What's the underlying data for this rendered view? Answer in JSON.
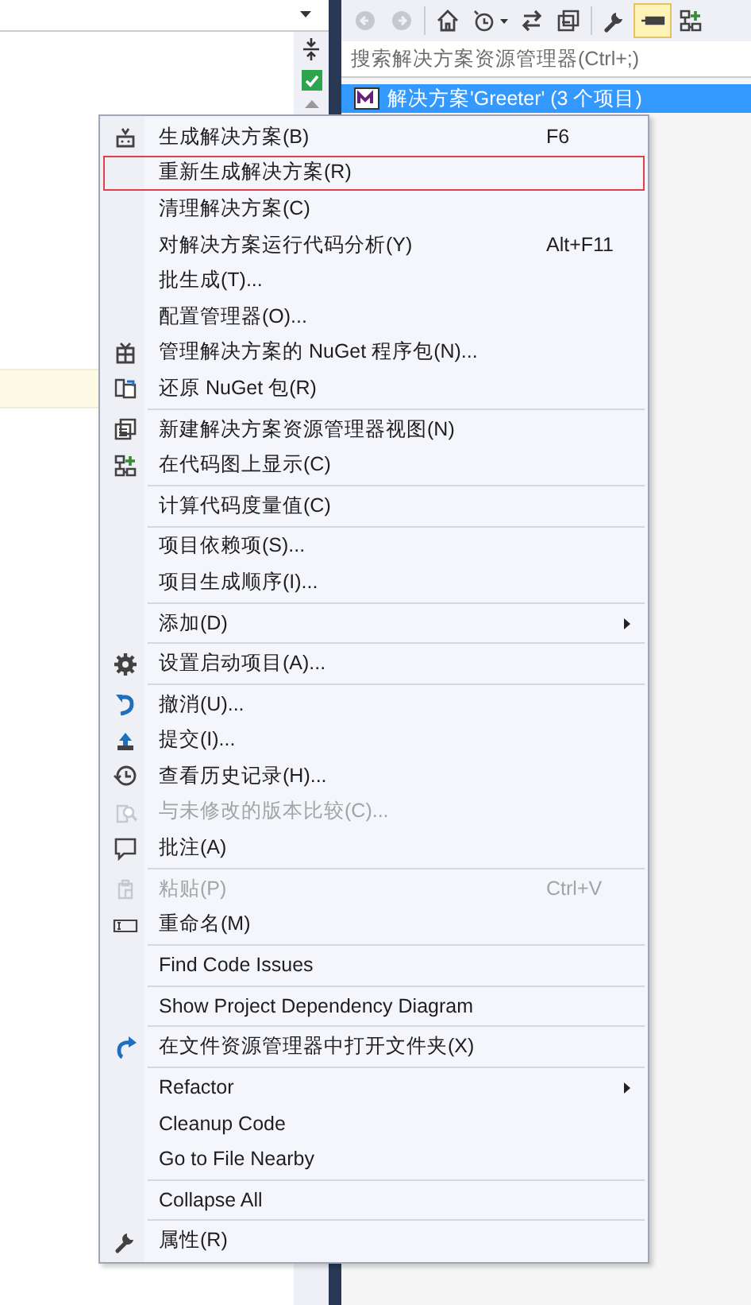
{
  "toolbar": {
    "buttons": [
      {
        "disabled": true,
        "selected": false
      },
      {
        "disabled": true,
        "selected": false
      },
      {
        "disabled": false,
        "selected": false
      },
      {
        "disabled": false,
        "selected": false
      },
      {
        "disabled": false,
        "selected": false
      },
      {
        "disabled": false,
        "selected": false
      },
      {
        "disabled": false,
        "selected": false
      },
      {
        "disabled": false,
        "selected": true
      },
      {
        "disabled": false,
        "selected": false
      }
    ]
  },
  "search": {
    "placeholder": "搜索解决方案资源管理器(Ctrl+;)"
  },
  "tree": {
    "items": [
      {
        "label": "解决方案'Greeter' (3 个项目)",
        "selected": true
      }
    ]
  },
  "context_menu": {
    "items": [
      {
        "kind": "item",
        "label": "生成解决方案(B)",
        "shortcut": "F6",
        "disabled": false,
        "selected": false
      },
      {
        "kind": "item",
        "label": "重新生成解决方案(R)",
        "disabled": false,
        "selected": true
      },
      {
        "kind": "item",
        "label": "清理解决方案(C)",
        "disabled": false,
        "selected": false
      },
      {
        "kind": "item",
        "label": "对解决方案运行代码分析(Y)",
        "shortcut": "Alt+F11",
        "disabled": false,
        "selected": false
      },
      {
        "kind": "item",
        "label": "批生成(T)...",
        "disabled": false,
        "selected": false
      },
      {
        "kind": "item",
        "label": "配置管理器(O)...",
        "disabled": false,
        "selected": false
      },
      {
        "kind": "item",
        "label": "管理解决方案的 NuGet 程序包(N)...",
        "disabled": false,
        "selected": false
      },
      {
        "kind": "item",
        "label": "还原 NuGet 包(R)",
        "disabled": false,
        "selected": false
      },
      {
        "kind": "separator"
      },
      {
        "kind": "item",
        "label": "新建解决方案资源管理器视图(N)",
        "disabled": false,
        "selected": false
      },
      {
        "kind": "item",
        "label": "在代码图上显示(C)",
        "disabled": false,
        "selected": false
      },
      {
        "kind": "separator"
      },
      {
        "kind": "item",
        "label": "计算代码度量值(C)",
        "disabled": false,
        "selected": false
      },
      {
        "kind": "separator"
      },
      {
        "kind": "item",
        "label": "项目依赖项(S)...",
        "disabled": false,
        "selected": false
      },
      {
        "kind": "item",
        "label": "项目生成顺序(I)...",
        "disabled": false,
        "selected": false
      },
      {
        "kind": "separator"
      },
      {
        "kind": "item",
        "label": "添加(D)",
        "submenu": true,
        "disabled": false,
        "selected": false
      },
      {
        "kind": "separator"
      },
      {
        "kind": "item",
        "label": "设置启动项目(A)...",
        "disabled": false,
        "selected": false
      },
      {
        "kind": "separator"
      },
      {
        "kind": "item",
        "label": "撤消(U)...",
        "disabled": false,
        "selected": false
      },
      {
        "kind": "item",
        "label": "提交(I)...",
        "disabled": false,
        "selected": false
      },
      {
        "kind": "item",
        "label": "查看历史记录(H)...",
        "disabled": false,
        "selected": false
      },
      {
        "kind": "item",
        "label": "与未修改的版本比较(C)...",
        "disabled": true,
        "selected": false
      },
      {
        "kind": "item",
        "label": "批注(A)",
        "disabled": false,
        "selected": false
      },
      {
        "kind": "separator"
      },
      {
        "kind": "item",
        "label": "粘贴(P)",
        "shortcut": "Ctrl+V",
        "disabled": true,
        "selected": false
      },
      {
        "kind": "item",
        "label": "重命名(M)",
        "disabled": false,
        "selected": false
      },
      {
        "kind": "separator"
      },
      {
        "kind": "item",
        "label": "Find Code Issues",
        "disabled": false,
        "selected": false
      },
      {
        "kind": "separator"
      },
      {
        "kind": "item",
        "label": "Show Project Dependency Diagram",
        "disabled": false,
        "selected": false
      },
      {
        "kind": "separator"
      },
      {
        "kind": "item",
        "label": "在文件资源管理器中打开文件夹(X)",
        "disabled": false,
        "selected": false
      },
      {
        "kind": "separator"
      },
      {
        "kind": "item",
        "label": "Refactor",
        "submenu": true,
        "disabled": false,
        "selected": false
      },
      {
        "kind": "item",
        "label": "Cleanup Code",
        "disabled": false,
        "selected": false
      },
      {
        "kind": "item",
        "label": "Go to File Nearby",
        "disabled": false,
        "selected": false
      },
      {
        "kind": "separator"
      },
      {
        "kind": "item",
        "label": "Collapse All",
        "disabled": false,
        "selected": false
      },
      {
        "kind": "separator"
      },
      {
        "kind": "item",
        "label": "属性(R)",
        "disabled": false,
        "selected": false
      }
    ]
  }
}
